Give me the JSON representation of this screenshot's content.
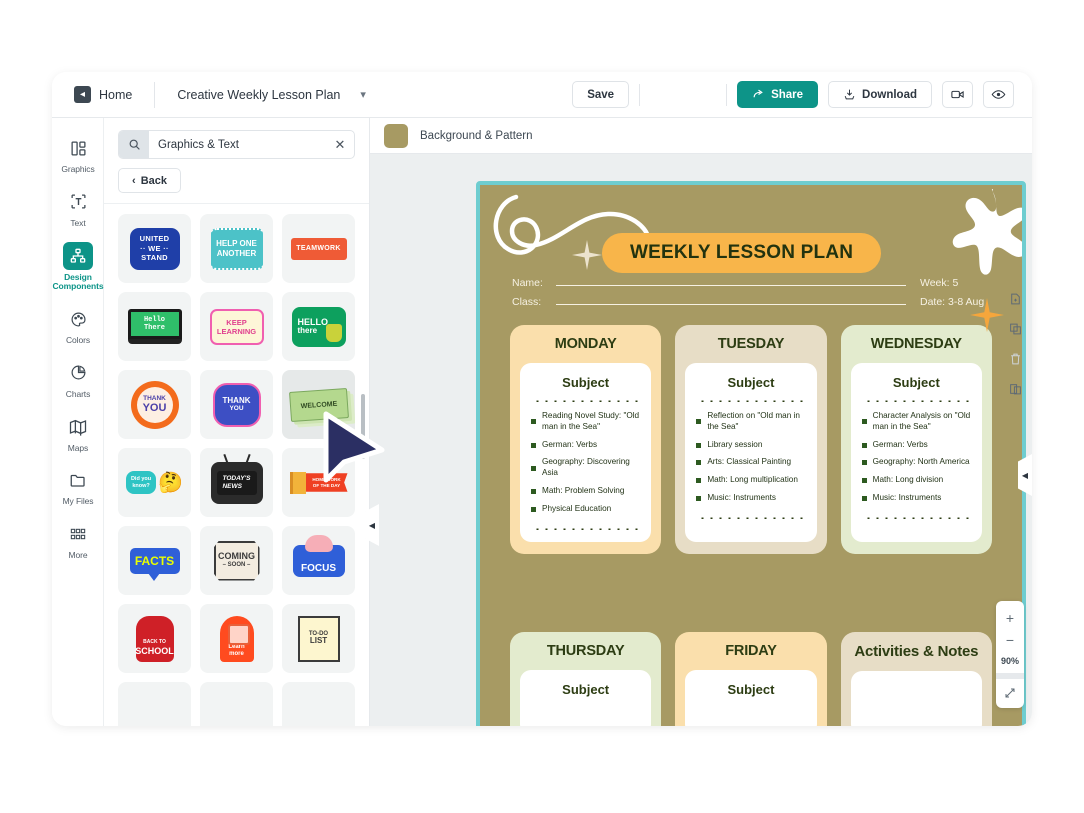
{
  "topbar": {
    "home_label": "Home",
    "home_icon": "back-chevron-icon",
    "doc_title": "Creative Weekly Lesson Plan",
    "caret_icon": "chevron-down-icon",
    "save_label": "Save",
    "undo_icon": "undo-icon",
    "redo_icon": "redo-icon",
    "share_label": "Share",
    "share_icon": "share-icon",
    "download_label": "Download",
    "download_icon": "download-icon",
    "record_icon": "video-camera-icon",
    "preview_icon": "eye-icon",
    "share_color": "#0d9488"
  },
  "rail": {
    "items": [
      {
        "label": "Graphics",
        "icon": "graphics-icon",
        "active": false
      },
      {
        "label": "Text",
        "icon": "text-icon",
        "active": false
      },
      {
        "label": "Design Components",
        "icon": "design-components-icon",
        "active": true
      },
      {
        "label": "Colors",
        "icon": "palette-icon",
        "active": false
      },
      {
        "label": "Charts",
        "icon": "pie-chart-icon",
        "active": false
      },
      {
        "label": "Maps",
        "icon": "map-icon",
        "active": false
      },
      {
        "label": "My Files",
        "icon": "folder-icon",
        "active": false
      },
      {
        "label": "More",
        "icon": "grid-dots-icon",
        "active": false
      }
    ]
  },
  "panel": {
    "search_value": "Graphics & Text",
    "search_placeholder": "Search",
    "search_icon": "search-icon",
    "clear_icon": "close-icon",
    "back_label": "Back",
    "back_icon": "chevron-left-icon",
    "stickers": [
      "UNITED WE STAND",
      "HELP ONE ANOTHER",
      "TEAMWORK",
      "Hello There",
      "KEEP LEARNING",
      "HELLO there",
      "THANK YOU",
      "THANK YOU",
      "WELCOME",
      "Did you know?",
      "TODAY'S NEWS",
      "HOMEWORK OF THE DAY",
      "FACTS",
      "COMING SOON",
      "FOCUS",
      "BACK TO SCHOOL",
      "Learn more",
      "TO-DO LIST"
    ]
  },
  "canvas": {
    "layer_label": "Background & Pattern",
    "layer_swatch": "#a79a63",
    "page_border_color": "#6ecdd0",
    "page_bg_color": "#a79a63",
    "title": "WEEKLY LESSON PLAN",
    "title_pill_color": "#f8b54a",
    "name_label": "Name:",
    "class_label": "Class:",
    "week_text": "Week: 5",
    "date_text": "Date: 3-8 Aug",
    "subject_heading": "Subject",
    "days": [
      {
        "name": "MONDAY",
        "bg": "#fadfac",
        "tasks": [
          "Reading Novel Study: \"Old man in the Sea\"",
          "German: Verbs",
          "Geography: Discovering Asia",
          "Math: Problem Solving",
          "Physical Education"
        ]
      },
      {
        "name": "TUESDAY",
        "bg": "#e7ddc6",
        "tasks": [
          "Reflection on \"Old man in the Sea\"",
          "Library session",
          "Arts: Classical Painting",
          "Math: Long multiplication",
          "Music: Instruments"
        ]
      },
      {
        "name": "WEDNESDAY",
        "bg": "#e3ebce",
        "tasks": [
          "Character Analysis on \"Old man in the Sea\"",
          "German: Verbs",
          "Geography: North America",
          "Math: Long division",
          "Music: Instruments"
        ]
      }
    ],
    "days2": [
      {
        "name": "THURSDAY",
        "bg": "#e3ebce",
        "subject": "Subject"
      },
      {
        "name": "FRIDAY",
        "bg": "#fadfac",
        "subject": "Subject"
      },
      {
        "name": "Activities & Notes",
        "bg": "#e7ddc6",
        "subject": ""
      }
    ],
    "page_tools": [
      {
        "icon": "add-page-icon",
        "disabled": false
      },
      {
        "icon": "duplicate-page-icon",
        "disabled": false
      },
      {
        "icon": "delete-page-icon",
        "disabled": true
      },
      {
        "icon": "copy-style-icon",
        "disabled": false
      }
    ],
    "zoom": {
      "in_icon": "plus-icon",
      "out_icon": "minus-icon",
      "level": "90%",
      "fit_icon": "fit-screen-icon"
    },
    "collapse_left_icon": "collapse-left-icon",
    "collapse_right_icon": "collapse-right-icon"
  }
}
